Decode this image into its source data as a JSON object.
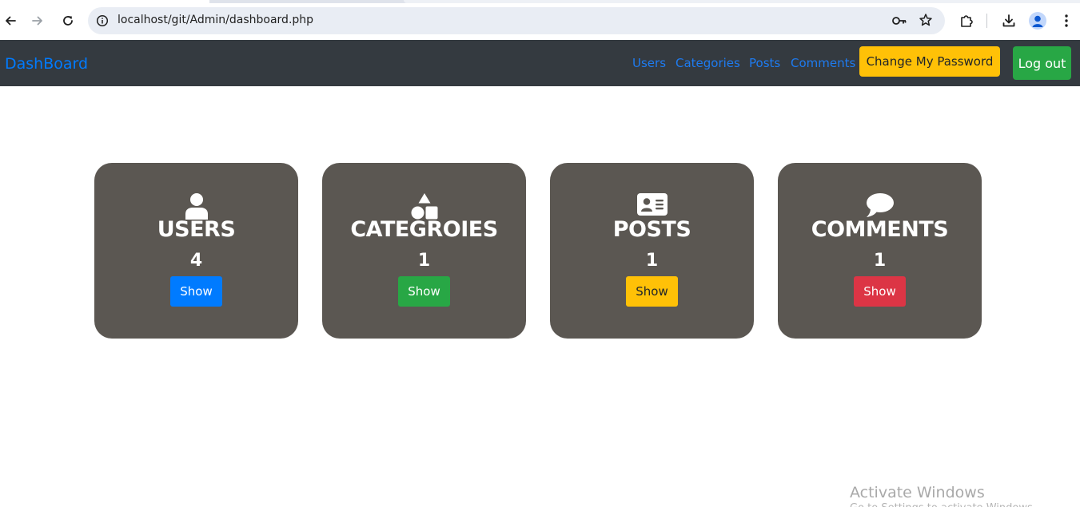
{
  "browser": {
    "url": "localhost/git/Admin/dashboard.php",
    "icons": {
      "back": "arrow-left-icon",
      "forward": "arrow-right-icon",
      "reload": "reload-icon",
      "site_info": "info-icon",
      "password_key": "key-icon",
      "bookmark": "star-icon",
      "extensions": "puzzle-icon",
      "downloads": "download-icon",
      "profile": "avatar-icon",
      "menu": "kebab-menu-icon"
    }
  },
  "navbar": {
    "brand": "DashBoard",
    "links": [
      "Users",
      "Categories",
      "Posts",
      "Comments"
    ],
    "change_password_label": "Change My Password",
    "logout_label": "Log out",
    "colors": {
      "background": "#343a40",
      "link": "#007bff",
      "warning": "#ffc107",
      "success": "#28a745"
    }
  },
  "cards": [
    {
      "title": "USERS",
      "count": "4",
      "button": "Show",
      "icon": "user-icon",
      "button_color": "#007bff"
    },
    {
      "title": "CATEGROIES",
      "count": "1",
      "button": "Show",
      "icon": "shapes-icon",
      "button_color": "#28a745"
    },
    {
      "title": "POSTS",
      "count": "1",
      "button": "Show",
      "icon": "id-card-icon",
      "button_color": "#ffc107"
    },
    {
      "title": "COMMENTS",
      "count": "1",
      "button": "Show",
      "icon": "comment-icon",
      "button_color": "#dc3545"
    }
  ],
  "card_color": "#5b5752",
  "watermark": {
    "title": "Activate Windows",
    "subtitle": "Go to Settings to activate Windows."
  }
}
